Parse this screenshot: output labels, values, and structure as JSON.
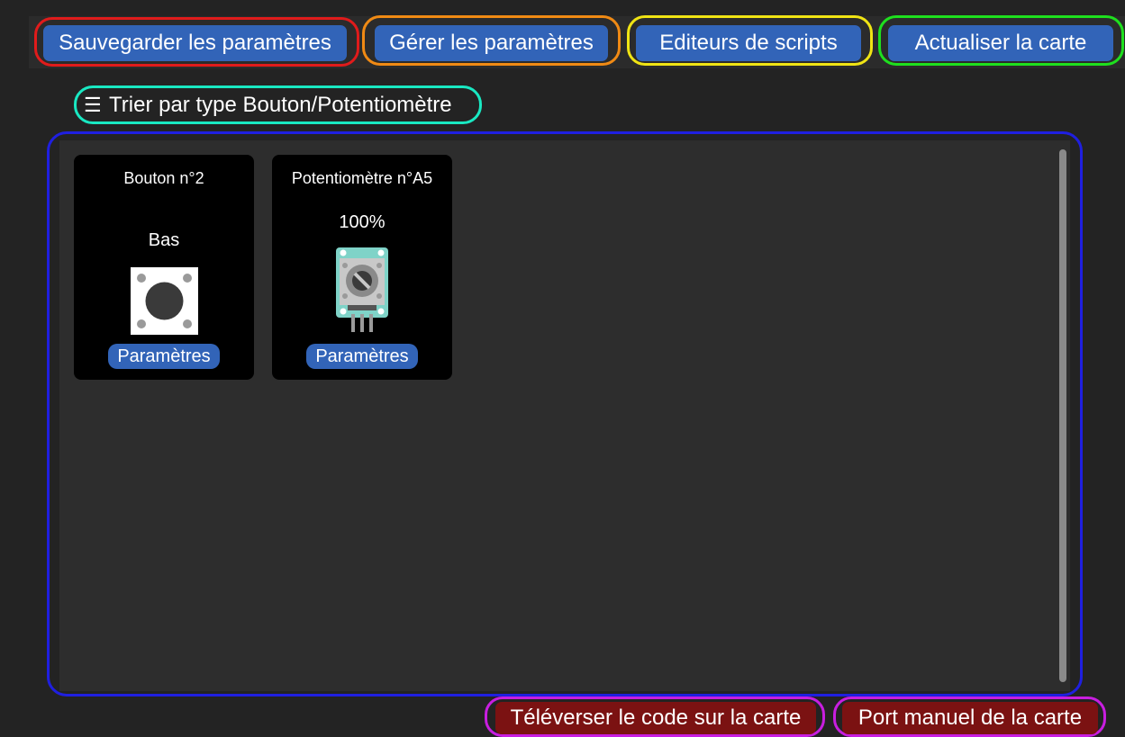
{
  "toolbar": {
    "save_label": "Sauvegarder les paramètres",
    "manage_label": "Gérer les paramètres",
    "scripts_label": "Editeurs de scripts",
    "refresh_label": "Actualiser la carte"
  },
  "sort": {
    "icon": "☰",
    "label": "Trier par type Bouton/Potentiomètre"
  },
  "cards": [
    {
      "title": "Bouton n°2",
      "value": "Bas",
      "icon": "push-button-icon",
      "settings_label": "Paramètres"
    },
    {
      "title": "Potentiomètre n°A5",
      "value": "100%",
      "icon": "potentiometer-icon",
      "settings_label": "Paramètres"
    }
  ],
  "footer": {
    "upload_label": "Téléverser le code sur la carte",
    "port_label": "Port manuel de la carte"
  },
  "colors": {
    "background": "#232323",
    "panel": "#2d2d2d",
    "button_blue": "#3264b8",
    "button_red": "#7b1212",
    "ring_red": "#e01b1b",
    "ring_orange": "#f08a14",
    "ring_yellow": "#f0e414",
    "ring_green": "#1ee01e",
    "ring_teal": "#19e8c2",
    "ring_blue": "#1f1fe0",
    "ring_magenta": "#c81ee0"
  }
}
